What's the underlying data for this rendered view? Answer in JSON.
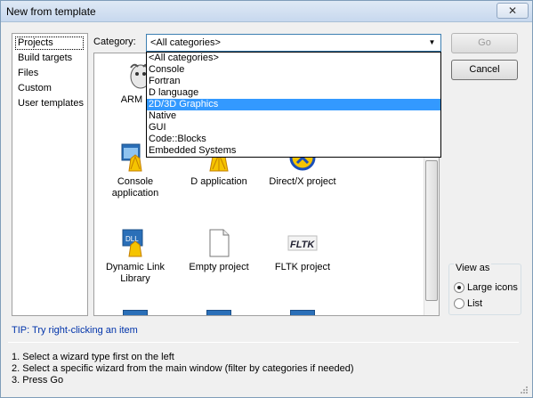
{
  "window": {
    "title": "New from template",
    "close_glyph": "✕"
  },
  "sidebar": {
    "items": [
      "Projects",
      "Build targets",
      "Files",
      "Custom",
      "User templates"
    ]
  },
  "category": {
    "label": "Category:",
    "selected": "<All categories>",
    "options": [
      "<All categories>",
      "Console",
      "Fortran",
      "D language",
      "2D/3D Graphics",
      "Native",
      "GUI",
      "Code::Blocks",
      "Embedded Systems"
    ],
    "highlighted": "2D/3D Graphics"
  },
  "tiles": [
    {
      "label": "ARM Pro",
      "icon": "gnu-icon"
    },
    {
      "label": "Console application",
      "icon": "console-shell-icon"
    },
    {
      "label": "D application",
      "icon": "shell-icon"
    },
    {
      "label": "Direct/X project",
      "icon": "directx-icon"
    },
    {
      "label": "Dynamic Link Library",
      "icon": "dll-icon"
    },
    {
      "label": "Empty project",
      "icon": "blank-page-icon"
    },
    {
      "label": "FLTK project",
      "icon": "fltk-icon"
    }
  ],
  "buttons": {
    "go": "Go",
    "cancel": "Cancel"
  },
  "view_as": {
    "legend": "View as",
    "options": [
      "Large icons",
      "List"
    ],
    "selected": "Large icons"
  },
  "tip": "TIP: Try right-clicking an item",
  "instructions": [
    "1. Select a wizard type first on the left",
    "2. Select a specific wizard from the main window (filter by categories if needed)",
    "3. Press Go"
  ]
}
